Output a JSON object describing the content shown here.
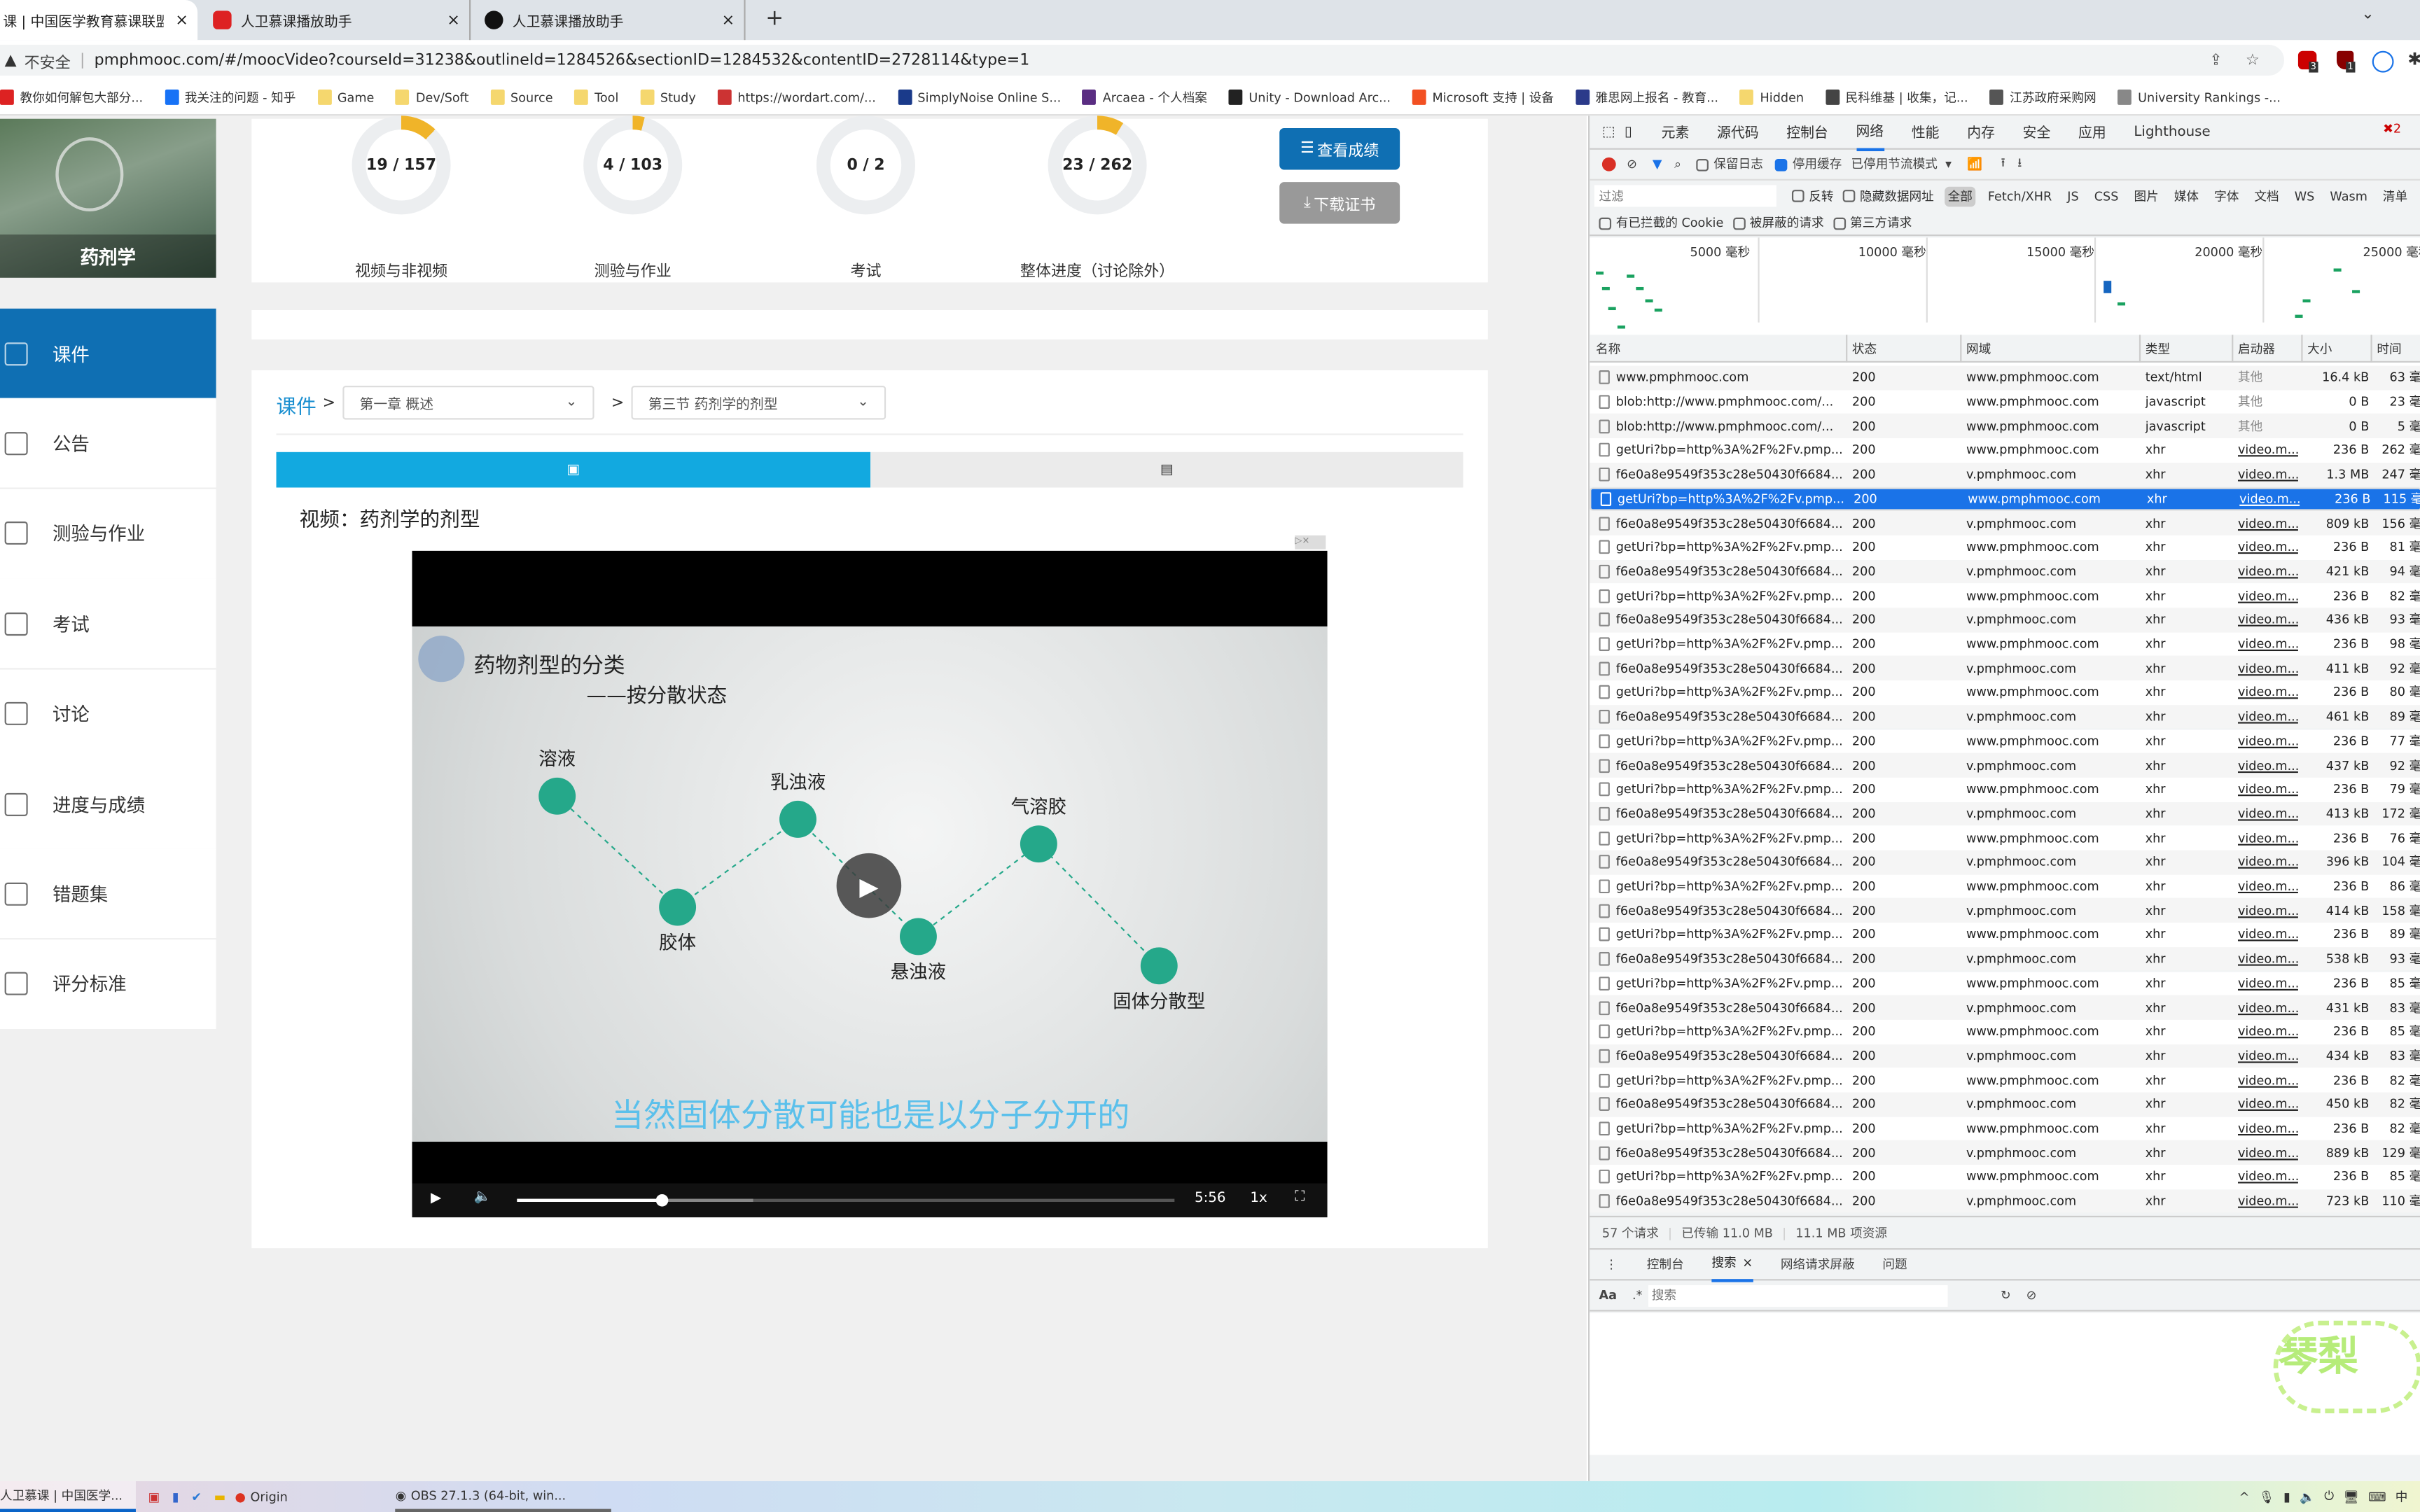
{
  "browser": {
    "tabs": [
      {
        "label": "课 | 中国医学教育慕课联盟官",
        "active": true
      },
      {
        "label": "人卫慕课播放助手",
        "active": false
      },
      {
        "label": "人卫慕课播放助手",
        "active": false
      }
    ],
    "new_tab": "+",
    "security": "不安全",
    "url": "pmphmooc.com/#/moocVideo?courseId=31238&outlineId=1284526&sectionID=1284532&contentID=2728114&type=1",
    "ext_badges": [
      "3",
      "1"
    ],
    "bookmarks": [
      "教你如何解包大部分...",
      "我关注的问题 - 知乎",
      "Game",
      "Dev/Soft",
      "Source",
      "Tool",
      "Study",
      "https://wordart.com/...",
      "SimplyNoise Online S...",
      "Arcaea - 个人档案",
      "Unity - Download Arc...",
      "Microsoft 支持 | 设备",
      "雅思网上报名 - 教育...",
      "Hidden",
      "民科维基 | 收集，记...",
      "江苏政府采购网",
      "University Rankings -..."
    ]
  },
  "course": {
    "name": "药剂学",
    "stats": [
      {
        "value": "19 / 157",
        "label": "视频与非视频",
        "fraction": 0.121
      },
      {
        "value": "4 / 103",
        "label": "测验与作业",
        "fraction": 0.039
      },
      {
        "value": "0 / 2",
        "label": "考试",
        "fraction": 0
      },
      {
        "value": "23 / 262",
        "label": "整体进度（讨论除外）",
        "fraction": 0.088
      }
    ],
    "view_score": "查看成绩",
    "download_cert": "下载证书",
    "progress_color": "#f0b429"
  },
  "sidebar": {
    "items": [
      {
        "label": "课件",
        "active": true
      },
      {
        "label": "公告"
      },
      {
        "label": "测验与作业"
      },
      {
        "label": "考试"
      },
      {
        "label": "讨论"
      },
      {
        "label": "进度与成绩"
      },
      {
        "label": "错题集"
      },
      {
        "label": "评分标准"
      }
    ],
    "accent": "#0f6fb3"
  },
  "content": {
    "breadcrumb_root": "课件",
    "sep": ">",
    "chapter": "第一章 概述",
    "section": "第三节 药剂学的剂型",
    "video_title": "视频：药剂学的剂型"
  },
  "video": {
    "slide_title": "药物剂型的分类",
    "slide_subtitle": "——按分散状态",
    "nodes": [
      "溶液",
      "胶体",
      "乳浊液",
      "悬浊液",
      "气溶胶",
      "固体分散型"
    ],
    "caption": "当然固体分散可能也是以分子分开的",
    "time": "5:56",
    "speed": "1x",
    "played": 0.22,
    "buffered": 0.36
  },
  "devtools": {
    "tabs": [
      "元素",
      "源代码",
      "控制台",
      "网络",
      "性能",
      "内存",
      "安全",
      "应用",
      "Lighthouse"
    ],
    "active_tab": "网络",
    "error_count": "2",
    "toolbar": {
      "preserve_log": "保留日志",
      "disable_cache": "停用缓存",
      "throttle": "已停用节流模式"
    },
    "filter_placeholder": "过滤",
    "invert": "反转",
    "hide_data_urls": "隐藏数据网址",
    "types": [
      "全部",
      "Fetch/XHR",
      "JS",
      "CSS",
      "图片",
      "媒体",
      "字体",
      "文档",
      "WS",
      "Wasm",
      "清单"
    ],
    "blocked_cookies": "有已拦截的 Cookie",
    "blocked_requests": "被屏蔽的请求",
    "third_party": "第三方请求",
    "timeline_ticks": [
      "5000 毫秒",
      "10000 毫秒",
      "15000 毫秒",
      "20000 毫秒",
      "25000 毫秒"
    ],
    "columns": [
      "名称",
      "状态",
      "网域",
      "类型",
      "启动器",
      "大小",
      "时间"
    ],
    "rows": [
      [
        "www.pmphmooc.com",
        "200",
        "www.pmphmooc.com",
        "text/html",
        "其他",
        "16.4 kB",
        "63 毫"
      ],
      [
        "blob:http://www.pmphmooc.com/...",
        "200",
        "www.pmphmooc.com",
        "javascript",
        "其他",
        "0 B",
        "23 毫"
      ],
      [
        "blob:http://www.pmphmooc.com/...",
        "200",
        "www.pmphmooc.com",
        "javascript",
        "其他",
        "0 B",
        "5 毫"
      ],
      [
        "getUri?bp=http%3A%2F%2Fv.pmp...",
        "200",
        "www.pmphmooc.com",
        "xhr",
        "video.m...",
        "236 B",
        "262 毫"
      ],
      [
        "f6e0a8e9549f353c28e50430f6684...",
        "200",
        "v.pmphmooc.com",
        "xhr",
        "video.m...",
        "1.3 MB",
        "247 毫"
      ],
      [
        "getUri?bp=http%3A%2F%2Fv.pmp...",
        "200",
        "www.pmphmooc.com",
        "xhr",
        "video.m...",
        "236 B",
        "115 毫"
      ],
      [
        "f6e0a8e9549f353c28e50430f6684...",
        "200",
        "v.pmphmooc.com",
        "xhr",
        "video.m...",
        "809 kB",
        "156 毫"
      ],
      [
        "getUri?bp=http%3A%2F%2Fv.pmp...",
        "200",
        "www.pmphmooc.com",
        "xhr",
        "video.m...",
        "236 B",
        "81 毫"
      ],
      [
        "f6e0a8e9549f353c28e50430f6684...",
        "200",
        "v.pmphmooc.com",
        "xhr",
        "video.m...",
        "421 kB",
        "94 毫"
      ],
      [
        "getUri?bp=http%3A%2F%2Fv.pmp...",
        "200",
        "www.pmphmooc.com",
        "xhr",
        "video.m...",
        "236 B",
        "82 毫"
      ],
      [
        "f6e0a8e9549f353c28e50430f6684...",
        "200",
        "v.pmphmooc.com",
        "xhr",
        "video.m...",
        "436 kB",
        "93 毫"
      ],
      [
        "getUri?bp=http%3A%2F%2Fv.pmp...",
        "200",
        "www.pmphmooc.com",
        "xhr",
        "video.m...",
        "236 B",
        "98 毫"
      ],
      [
        "f6e0a8e9549f353c28e50430f6684...",
        "200",
        "v.pmphmooc.com",
        "xhr",
        "video.m...",
        "411 kB",
        "92 毫"
      ],
      [
        "getUri?bp=http%3A%2F%2Fv.pmp...",
        "200",
        "www.pmphmooc.com",
        "xhr",
        "video.m...",
        "236 B",
        "80 毫"
      ],
      [
        "f6e0a8e9549f353c28e50430f6684...",
        "200",
        "v.pmphmooc.com",
        "xhr",
        "video.m...",
        "461 kB",
        "89 毫"
      ],
      [
        "getUri?bp=http%3A%2F%2Fv.pmp...",
        "200",
        "www.pmphmooc.com",
        "xhr",
        "video.m...",
        "236 B",
        "77 毫"
      ],
      [
        "f6e0a8e9549f353c28e50430f6684...",
        "200",
        "v.pmphmooc.com",
        "xhr",
        "video.m...",
        "437 kB",
        "92 毫"
      ],
      [
        "getUri?bp=http%3A%2F%2Fv.pmp...",
        "200",
        "www.pmphmooc.com",
        "xhr",
        "video.m...",
        "236 B",
        "79 毫"
      ],
      [
        "f6e0a8e9549f353c28e50430f6684...",
        "200",
        "v.pmphmooc.com",
        "xhr",
        "video.m...",
        "413 kB",
        "172 毫"
      ],
      [
        "getUri?bp=http%3A%2F%2Fv.pmp...",
        "200",
        "www.pmphmooc.com",
        "xhr",
        "video.m...",
        "236 B",
        "76 毫"
      ],
      [
        "f6e0a8e9549f353c28e50430f6684...",
        "200",
        "v.pmphmooc.com",
        "xhr",
        "video.m...",
        "396 kB",
        "104 毫"
      ],
      [
        "getUri?bp=http%3A%2F%2Fv.pmp...",
        "200",
        "www.pmphmooc.com",
        "xhr",
        "video.m...",
        "236 B",
        "86 毫"
      ],
      [
        "f6e0a8e9549f353c28e50430f6684...",
        "200",
        "v.pmphmooc.com",
        "xhr",
        "video.m...",
        "414 kB",
        "158 毫"
      ],
      [
        "getUri?bp=http%3A%2F%2Fv.pmp...",
        "200",
        "www.pmphmooc.com",
        "xhr",
        "video.m...",
        "236 B",
        "89 毫"
      ],
      [
        "f6e0a8e9549f353c28e50430f6684...",
        "200",
        "v.pmphmooc.com",
        "xhr",
        "video.m...",
        "538 kB",
        "93 毫"
      ],
      [
        "getUri?bp=http%3A%2F%2Fv.pmp...",
        "200",
        "www.pmphmooc.com",
        "xhr",
        "video.m...",
        "236 B",
        "85 毫"
      ],
      [
        "f6e0a8e9549f353c28e50430f6684...",
        "200",
        "v.pmphmooc.com",
        "xhr",
        "video.m...",
        "431 kB",
        "83 毫"
      ],
      [
        "getUri?bp=http%3A%2F%2Fv.pmp...",
        "200",
        "www.pmphmooc.com",
        "xhr",
        "video.m...",
        "236 B",
        "85 毫"
      ],
      [
        "f6e0a8e9549f353c28e50430f6684...",
        "200",
        "v.pmphmooc.com",
        "xhr",
        "video.m...",
        "434 kB",
        "83 毫"
      ],
      [
        "getUri?bp=http%3A%2F%2Fv.pmp...",
        "200",
        "www.pmphmooc.com",
        "xhr",
        "video.m...",
        "236 B",
        "82 毫"
      ],
      [
        "f6e0a8e9549f353c28e50430f6684...",
        "200",
        "v.pmphmooc.com",
        "xhr",
        "video.m...",
        "450 kB",
        "82 毫"
      ],
      [
        "getUri?bp=http%3A%2F%2Fv.pmp...",
        "200",
        "www.pmphmooc.com",
        "xhr",
        "video.m...",
        "236 B",
        "82 毫"
      ],
      [
        "f6e0a8e9549f353c28e50430f6684...",
        "200",
        "v.pmphmooc.com",
        "xhr",
        "video.m...",
        "889 kB",
        "129 毫"
      ],
      [
        "getUri?bp=http%3A%2F%2Fv.pmp...",
        "200",
        "www.pmphmooc.com",
        "xhr",
        "video.m...",
        "236 B",
        "85 毫"
      ],
      [
        "f6e0a8e9549f353c28e50430f6684...",
        "200",
        "v.pmphmooc.com",
        "xhr",
        "video.m...",
        "723 kB",
        "110 毫"
      ]
    ],
    "selected_row": 5,
    "summary": [
      "57 个请求",
      "已传输 11.0 MB",
      "11.1 MB 项资源"
    ],
    "drawer_tabs": [
      "控制台",
      "搜索",
      "网络请求屏蔽",
      "问题"
    ],
    "drawer_active": "搜索",
    "search_case": "Aa",
    "search_regex": ".*",
    "search_placeholder": "搜索"
  },
  "taskbar": {
    "items": [
      "人卫慕课 | 中国医学...",
      "Origin",
      "OBS 27.1.3 (64-bit, win..."
    ],
    "ime": "中"
  }
}
